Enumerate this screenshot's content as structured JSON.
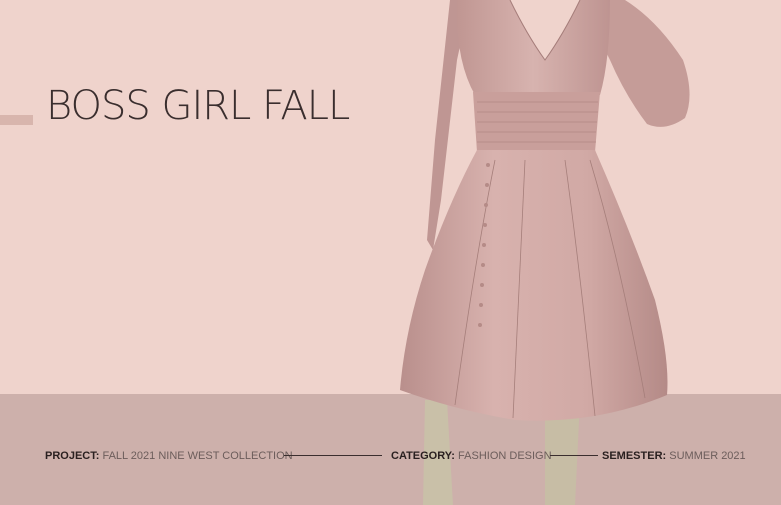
{
  "title": "BOSS GIRL FALL",
  "footer": {
    "project_label": "PROJECT:",
    "project_value": "FALL 2021 NINE WEST COLLECTION",
    "category_label": "CATEGORY:",
    "category_value": "FASHION DESIGN",
    "semester_label": "SEMESTER:",
    "semester_value": "SUMMER 2021"
  },
  "colors": {
    "background": "#efd3cc",
    "band": "#cdb0ab",
    "dress": "#d1a8a5",
    "text": "#3a2e2e"
  }
}
